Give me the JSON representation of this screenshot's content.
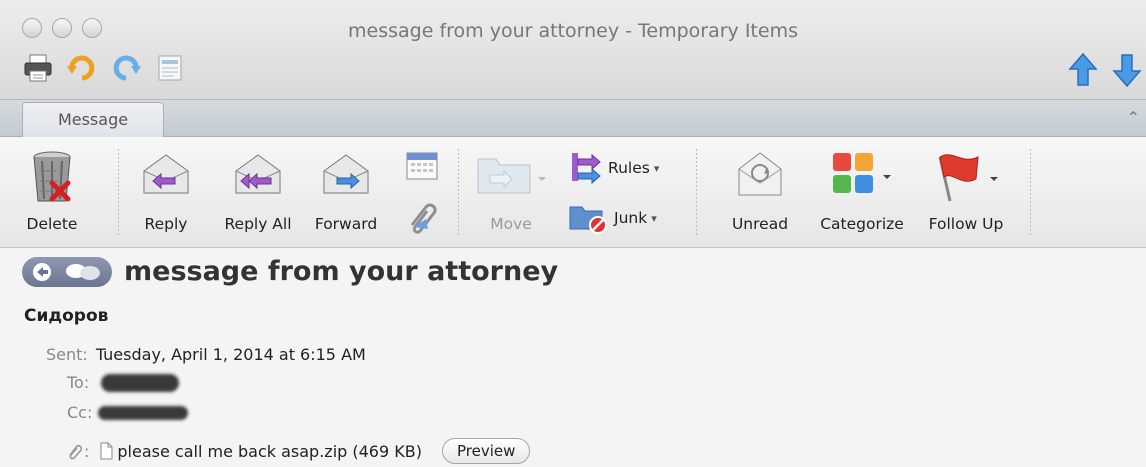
{
  "window": {
    "title": "message from your attorney - Temporary Items"
  },
  "tabs": [
    {
      "label": "Message",
      "selected": true
    }
  ],
  "ribbon": {
    "delete": "Delete",
    "reply": "Reply",
    "reply_all": "Reply All",
    "forward": "Forward",
    "move": "Move",
    "rules": "Rules",
    "junk": "Junk",
    "unread": "Unread",
    "categorize": "Categorize",
    "follow_up": "Follow Up"
  },
  "message": {
    "subject": "message from your attorney",
    "sender": "Сидоров",
    "sent_label": "Sent:",
    "sent_value": "Tuesday, April 1, 2014 at 6:15 AM",
    "to_label": "To:",
    "cc_label": "Cc:",
    "attachment_label": ":",
    "attachment_name": "please call me back asap.zip (469 KB)",
    "preview_label": "Preview"
  },
  "icons": [
    "print-icon",
    "undo-icon",
    "redo-icon",
    "document-icon",
    "up-arrow-icon",
    "down-arrow-icon",
    "trash-icon",
    "reply-icon",
    "reply-all-icon",
    "forward-icon",
    "calendar-icon",
    "attachment-icon",
    "folder-icon",
    "rules-icon",
    "junk-icon",
    "unread-icon",
    "categories-icon",
    "flag-icon"
  ],
  "colors": {
    "accent": "#3b7fd6",
    "flag": "#d62c2c",
    "reply_arrow": "#8b4bbf",
    "forward_arrow": "#3b7fd6"
  }
}
